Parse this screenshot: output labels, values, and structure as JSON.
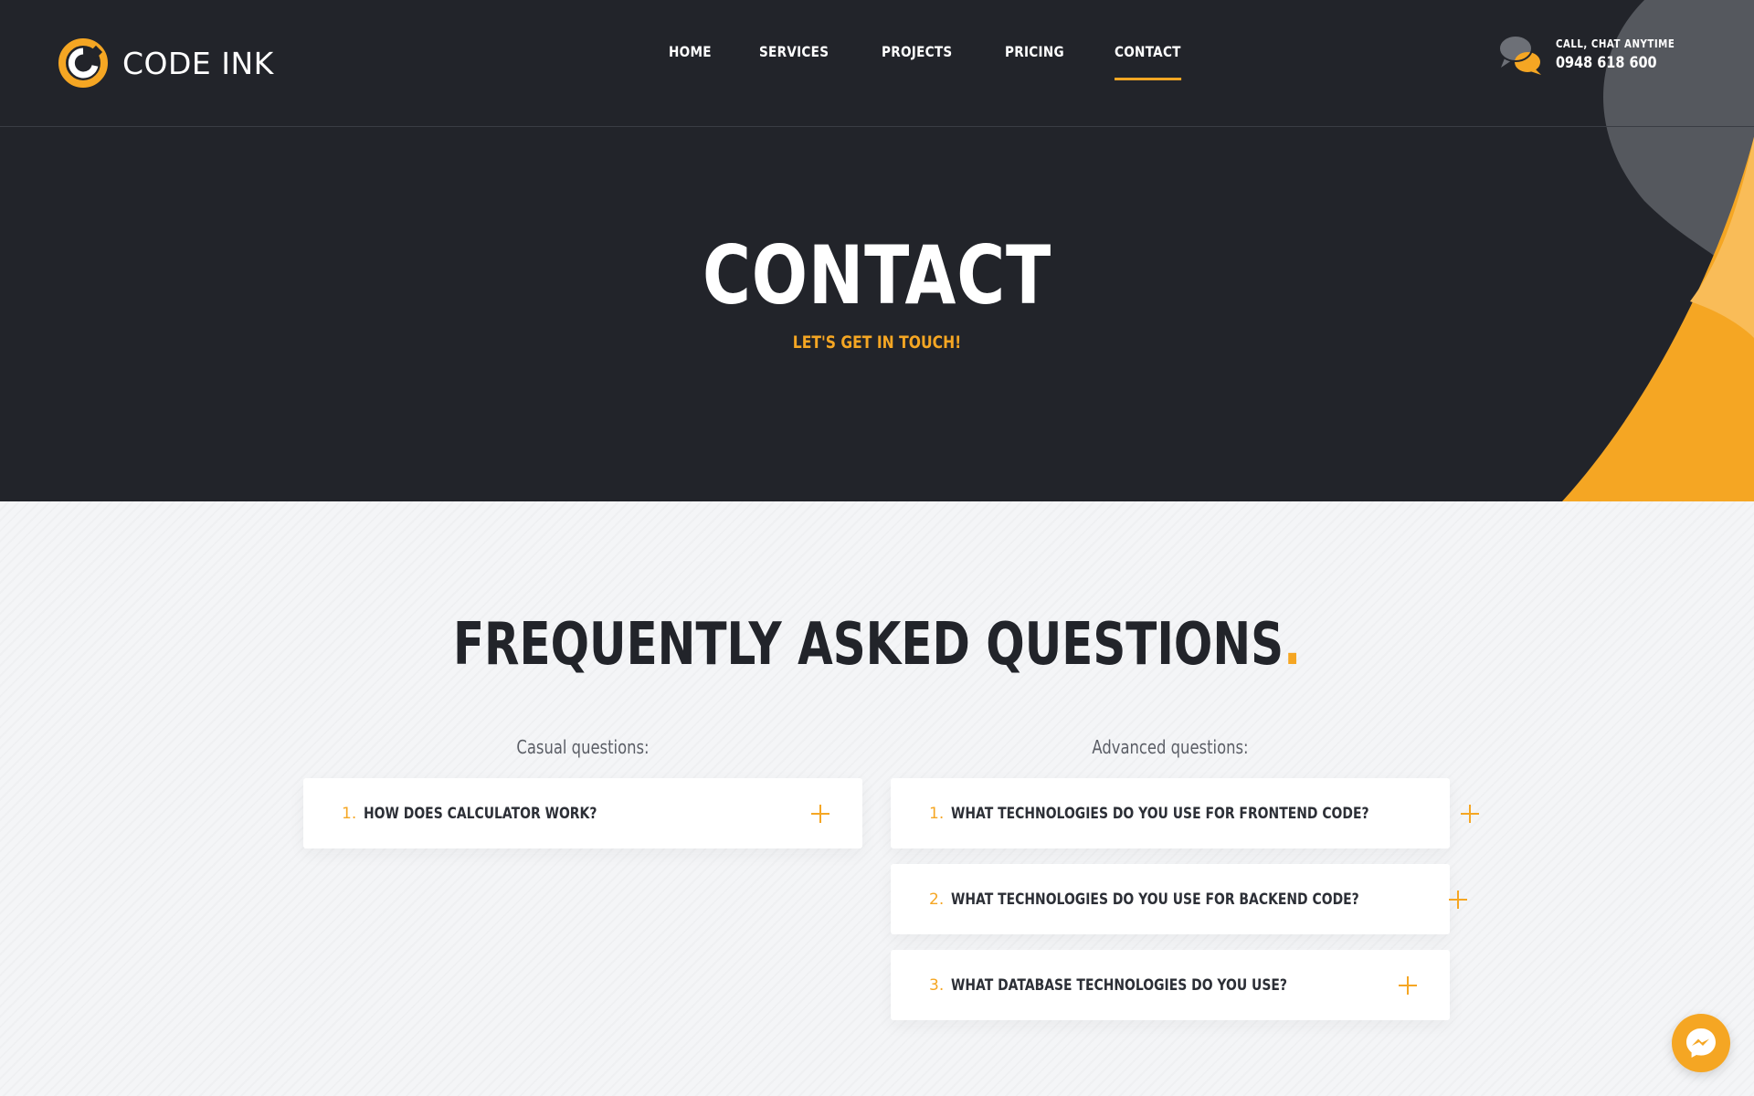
{
  "brand": {
    "name": "CODE INK"
  },
  "nav": {
    "items": [
      {
        "label": "HOME"
      },
      {
        "label": "SERVICES"
      },
      {
        "label": "PROJECTS"
      },
      {
        "label": "PRICING"
      },
      {
        "label": "CONTACT",
        "active": true
      }
    ]
  },
  "contact": {
    "label": "CALL, CHAT ANYTIME",
    "phone": "0948 618 600"
  },
  "hero": {
    "title": "CONTACT",
    "subtitle": "LET'S GET IN TOUCH!"
  },
  "faq": {
    "title": "FREQUENTLY ASKED QUESTIONS",
    "title_dot": ".",
    "casual": {
      "label": "Casual questions:",
      "items": [
        {
          "num": "1.",
          "question": "HOW DOES CALCULATOR WORK?"
        }
      ]
    },
    "advanced": {
      "label": "Advanced questions:",
      "items": [
        {
          "num": "1.",
          "question": "WHAT TECHNOLOGIES DO YOU USE FOR FRONTEND CODE?"
        },
        {
          "num": "2.",
          "question": "WHAT TECHNOLOGIES DO YOU USE FOR BACKEND CODE?"
        },
        {
          "num": "3.",
          "question": "WHAT DATABASE TECHNOLOGIES DO YOU USE?"
        }
      ]
    }
  },
  "colors": {
    "accent": "#f5a623",
    "dark": "#22242a",
    "light_bg": "#f3f4f6"
  },
  "icons": {
    "logo": "code-ink-logo-icon",
    "chat": "chat-bubbles-icon",
    "expand": "plus-icon",
    "messenger": "messenger-icon"
  }
}
